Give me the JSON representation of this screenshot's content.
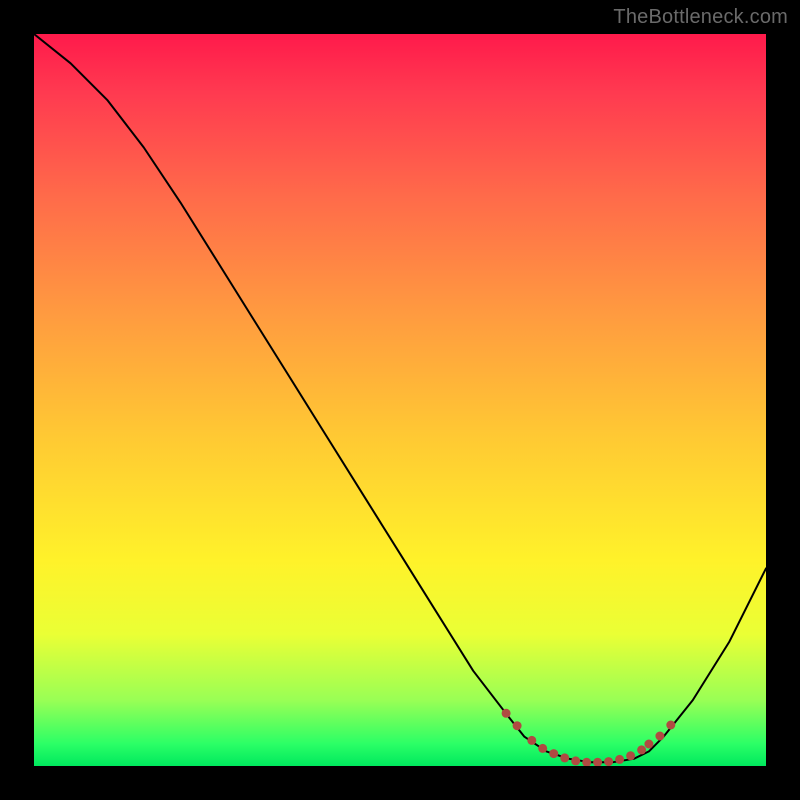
{
  "watermark": "TheBottleneck.com",
  "chart_data": {
    "type": "line",
    "title": "",
    "xlabel": "",
    "ylabel": "",
    "series": [
      {
        "name": "curve",
        "x": [
          0,
          5,
          10,
          15,
          20,
          25,
          30,
          35,
          40,
          45,
          50,
          55,
          60,
          65,
          67,
          70,
          73,
          76,
          79,
          82,
          84,
          86,
          90,
          95,
          100
        ],
        "y": [
          100,
          96,
          91,
          84.5,
          77,
          69,
          61,
          53,
          45,
          37,
          29,
          21,
          13,
          6.5,
          4,
          2,
          1,
          0.5,
          0.5,
          1,
          2,
          4,
          9,
          17,
          27
        ]
      }
    ],
    "markers": {
      "comment": "Salmon dashed segment near the trough",
      "x": [
        64.5,
        66,
        68,
        69.5,
        71,
        72.5,
        74,
        75.5,
        77,
        78.5,
        80,
        81.5,
        83,
        84,
        85.5,
        87
      ],
      "y": [
        7.2,
        5.5,
        3.5,
        2.4,
        1.7,
        1.1,
        0.7,
        0.5,
        0.5,
        0.6,
        0.9,
        1.4,
        2.2,
        3.0,
        4.1,
        5.6
      ]
    },
    "xlim": [
      0,
      100
    ],
    "ylim": [
      0,
      100
    ],
    "grid": false
  },
  "colors": {
    "marker": "#b04a42",
    "curve": "#000000"
  }
}
